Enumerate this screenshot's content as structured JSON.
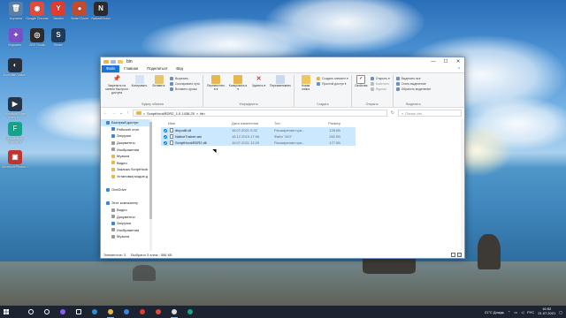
{
  "desktop": {
    "icons": [
      {
        "label": "Корзина",
        "color": "#5a7fa8",
        "glyph": "🗑"
      },
      {
        "label": "Google Chrome",
        "color": "#e24a3b",
        "glyph": "◉"
      },
      {
        "label": "Yandex",
        "color": "#e03b2f",
        "glyph": "Y"
      },
      {
        "label": "Smart Zoom",
        "color": "#c44a2e",
        "glyph": "●"
      },
      {
        "label": "NaturalVision",
        "color": "#2b2b2b",
        "glyph": "N"
      },
      {
        "label": "Hogwarts...",
        "color": "#7b4fc9",
        "glyph": "✦"
      },
      {
        "label": "OBS Studio",
        "color": "#2c2c2c",
        "glyph": "◎"
      },
      {
        "label": "Steam",
        "color": "#1b3a5c",
        "glyph": "S"
      },
      {
        "label": "Clownfish Voice...",
        "color": "#27303c",
        "glyph": "◐"
      },
      {
        "label": "Microsoft Edge Video Vi...",
        "color": "#25354a",
        "glyph": "▶"
      },
      {
        "label": "Wondershare Filmora X",
        "color": "#14a48a",
        "glyph": "F"
      },
      {
        "label": "Microsoft Photos...",
        "color": "#c6322c",
        "glyph": "▣"
      }
    ]
  },
  "window": {
    "title": "bin",
    "min_glyph": "—",
    "max_glyph": "☐",
    "close_glyph": "✕",
    "menu": {
      "file": "Файл",
      "home": "Главная",
      "share": "Поделиться",
      "view": "Вид",
      "help": "?"
    },
    "ribbon": {
      "clipboard": {
        "pin": "Закрепить на панели быстрого доступа",
        "copy": "Копировать",
        "paste": "Вставить",
        "cut": "Вырезать",
        "copy_path": "Скопировать путь",
        "paste_shortcut": "Вставить ярлык",
        "label": "Буфер обмена"
      },
      "organize": {
        "move": "Переместить в ▾",
        "copy_to": "Копировать в ▾",
        "delete": "Удалить ▾",
        "rename": "Переименовать",
        "label": "Упорядочить"
      },
      "new": {
        "new_folder": "Новая папка",
        "new_item": "Создать элемент ▾",
        "easy_access": "Простой доступ ▾",
        "label": "Создать"
      },
      "open": {
        "properties": "Свойства",
        "open": "Открыть ▾",
        "edit": "Изменить",
        "history": "Журнал",
        "label": "Открыть"
      },
      "select": {
        "select_all": "Выделить все",
        "select_none": "Снять выделение",
        "invert": "Обратить выделение",
        "label": "Выделить"
      }
    },
    "address": {
      "back": "←",
      "forward": "→",
      "up_recent": "⌄",
      "up": "↑",
      "path_1": "ScriptHookRDR2_1.0.1436.25",
      "sep": ">",
      "path_2": "bin",
      "refresh": "↻",
      "search_placeholder": "Поиск: bin"
    },
    "nav": [
      {
        "label": "Быстрый доступ",
        "color": "#3b86d6",
        "selected": true
      },
      {
        "label": "Рабочий стол",
        "color": "#3b86d6"
      },
      {
        "label": "Загрузки",
        "color": "#3b86d6"
      },
      {
        "label": "Документы",
        "color": "#9a9a9a"
      },
      {
        "label": "Изображения",
        "color": "#9a9a9a"
      },
      {
        "label": "Музыка",
        "color": "#e8b64a"
      },
      {
        "label": "Видео",
        "color": "#e8b64a"
      },
      {
        "label": "Закачка ScriptHook",
        "color": "#e8b64a"
      },
      {
        "label": "Установка модов д",
        "color": "#e8b64a"
      },
      {
        "label": "",
        "color": "transparent"
      },
      {
        "label": "OneDrive",
        "color": "#3b86d6"
      },
      {
        "label": "",
        "color": "transparent"
      },
      {
        "label": "Этот компьютер",
        "color": "#3b86d6"
      },
      {
        "label": "Видео",
        "color": "#9a9a9a"
      },
      {
        "label": "Документы",
        "color": "#9a9a9a"
      },
      {
        "label": "Загрузки",
        "color": "#3b86d6"
      },
      {
        "label": "Изображения",
        "color": "#9a9a9a"
      },
      {
        "label": "Музыка",
        "color": "#9a9a9a"
      }
    ],
    "columns": {
      "name": "Имя",
      "date": "Дата изменения",
      "type": "Тип",
      "size": "Размер"
    },
    "files": [
      {
        "name": "dinput8.dll",
        "date": "18.07.2021 9:32",
        "type": "Расширение при...",
        "size": "128 КБ"
      },
      {
        "name": "NativeTrainer.asi",
        "date": "16.12.2019 17:06",
        "type": "Файл \"ASI\"",
        "size": "282 КБ"
      },
      {
        "name": "ScriptHookRDR2.dll",
        "date": "18.07.2021 12:29",
        "type": "Расширение при...",
        "size": "177 КБ"
      }
    ],
    "status": {
      "count": "Элементов: 3",
      "selected": "Выбрано 3 элем.: 586 КБ"
    }
  },
  "taskbar": {
    "apps": [
      {
        "name": "search",
        "color": "#ffffff"
      },
      {
        "name": "cortana",
        "color": "#ffffff"
      },
      {
        "name": "alice",
        "color": "#8a5cf5"
      },
      {
        "name": "task-view",
        "color": "#ffffff"
      },
      {
        "name": "edge",
        "color": "#2a8fd6"
      },
      {
        "name": "explorer",
        "color": "#e8b64a"
      },
      {
        "name": "store",
        "color": "#3b86d6"
      },
      {
        "name": "yandex",
        "color": "#e03b2f"
      },
      {
        "name": "chrome",
        "color": "#e24a3b"
      },
      {
        "name": "obs",
        "color": "#dddddd"
      },
      {
        "name": "filmora",
        "color": "#14a48a"
      }
    ],
    "weather": "21°C Дождь",
    "lang": "РУС",
    "time": "16:52",
    "date": "21.07.2021"
  }
}
